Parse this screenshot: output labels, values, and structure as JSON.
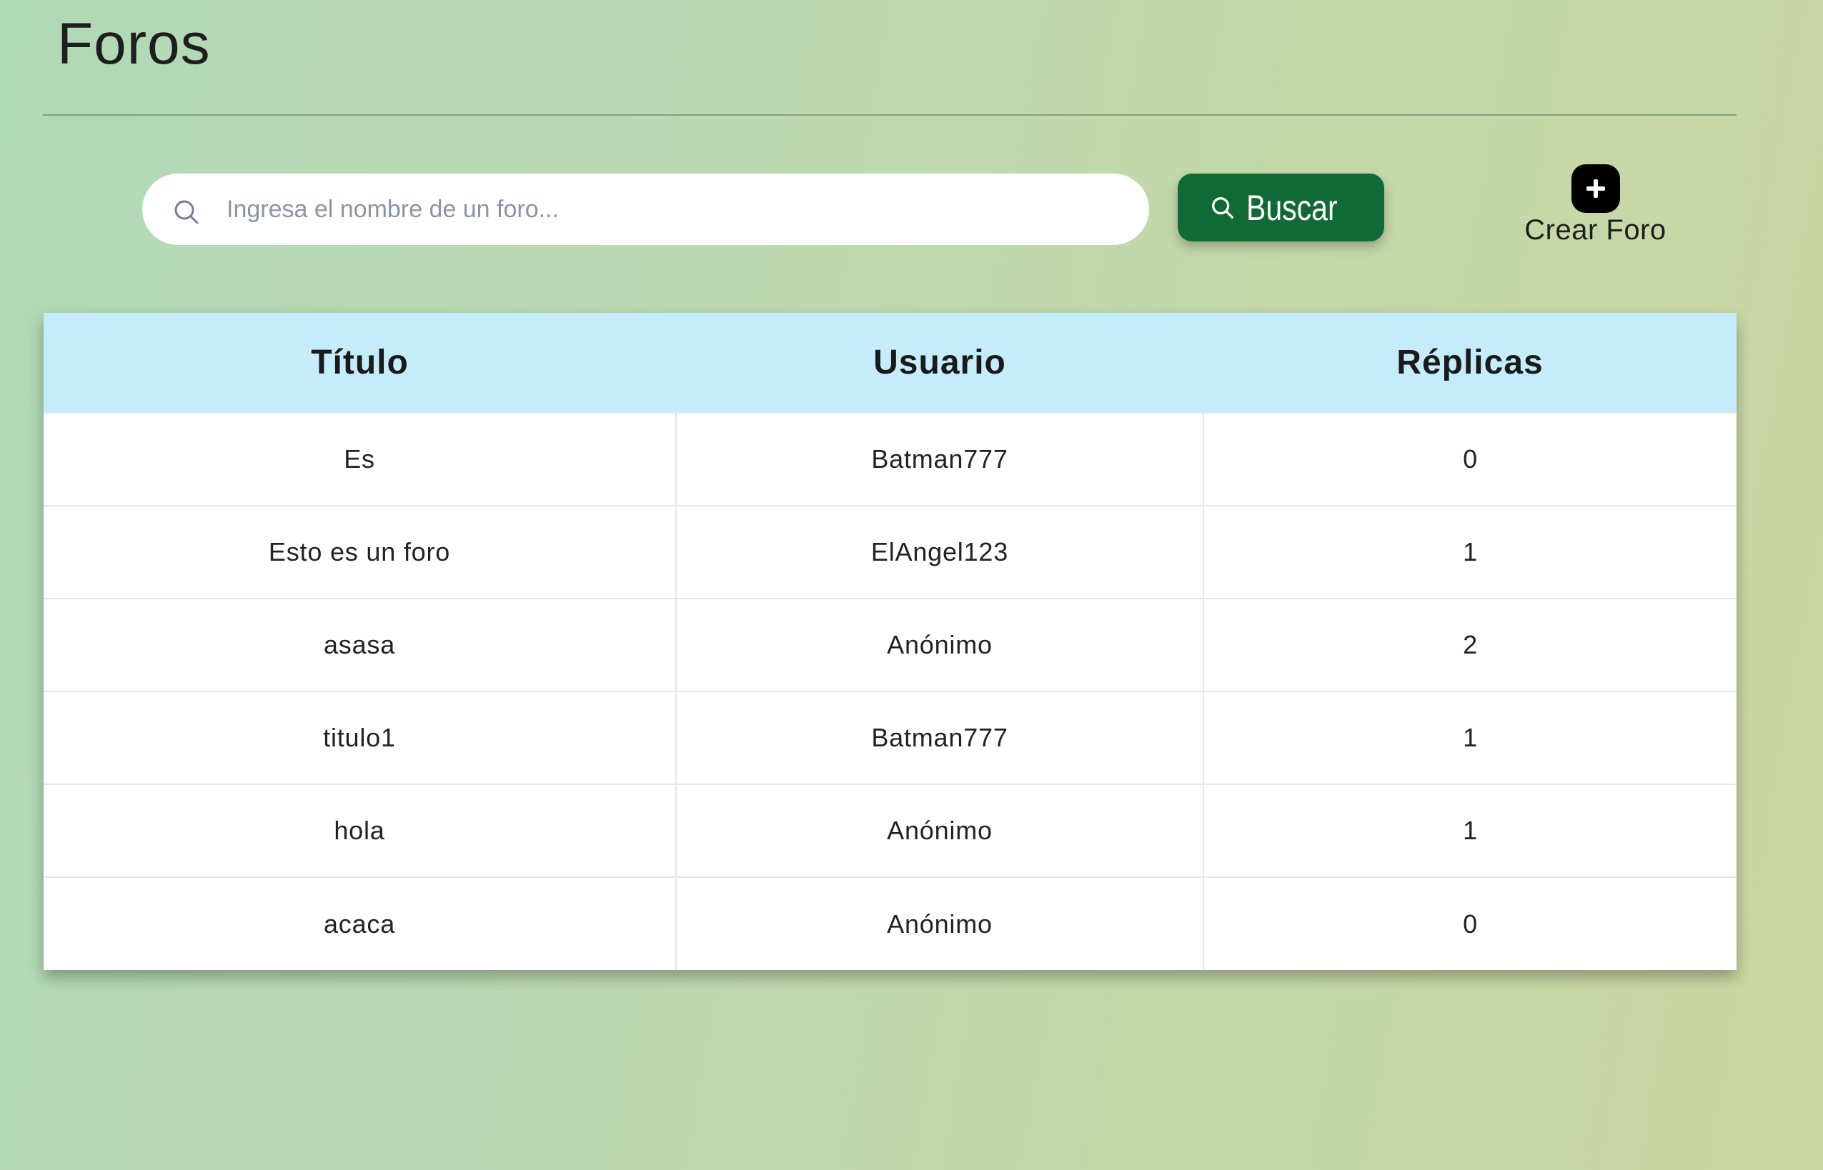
{
  "page": {
    "title": "Foros"
  },
  "search": {
    "placeholder": "Ingresa el nombre de un foro...",
    "value": "",
    "icon": "search-icon"
  },
  "buscar_button": {
    "label": "Buscar",
    "icon": "search-icon",
    "color": "#0f6a35"
  },
  "crear_foro": {
    "label": "Crear Foro",
    "icon": "plus-icon"
  },
  "table": {
    "header_color": "#c4ecfb",
    "columns": [
      "Título",
      "Usuario",
      "Réplicas"
    ],
    "rows": [
      {
        "titulo": "Es",
        "usuario": "Batman777",
        "replicas": "0"
      },
      {
        "titulo": "Esto es un foro",
        "usuario": "ElAngel123",
        "replicas": "1"
      },
      {
        "titulo": "asasa",
        "usuario": "Anónimo",
        "replicas": "2"
      },
      {
        "titulo": "titulo1",
        "usuario": "Batman777",
        "replicas": "1"
      },
      {
        "titulo": "hola",
        "usuario": "Anónimo",
        "replicas": "1"
      },
      {
        "titulo": "acaca",
        "usuario": "Anónimo",
        "replicas": "0"
      }
    ]
  }
}
